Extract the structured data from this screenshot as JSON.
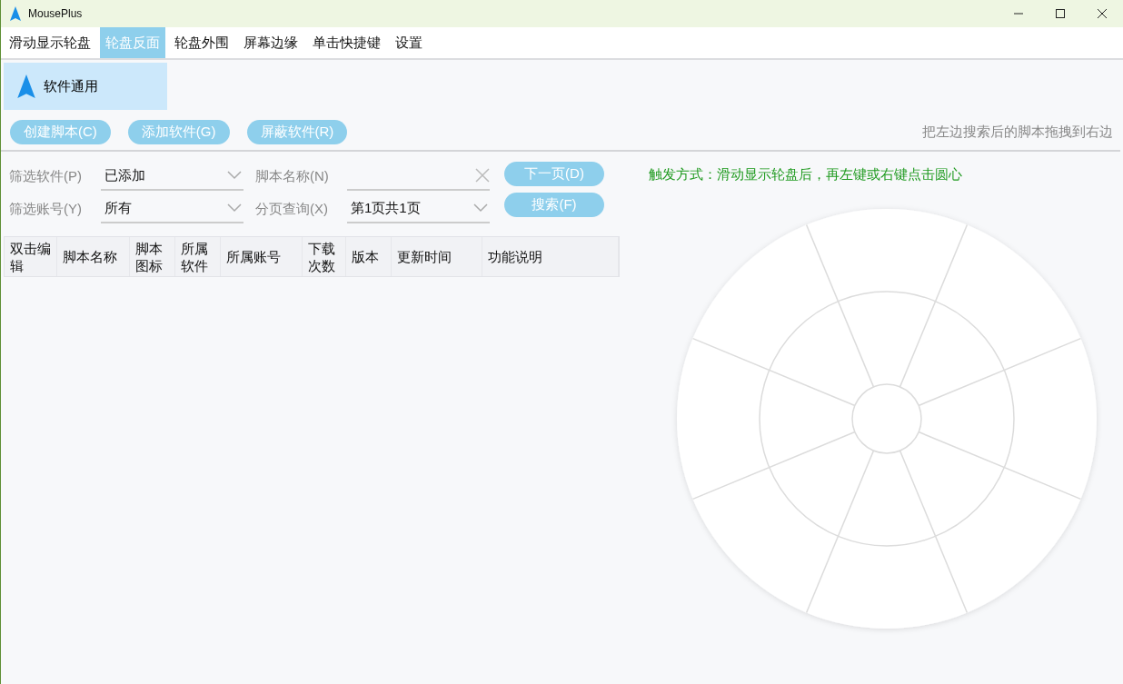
{
  "window": {
    "title": "MousePlus"
  },
  "menu": [
    {
      "label": "滑动显示轮盘",
      "selected": false
    },
    {
      "label": "轮盘反面",
      "selected": true
    },
    {
      "label": "轮盘外围",
      "selected": false
    },
    {
      "label": "屏幕边缘",
      "selected": false
    },
    {
      "label": "单击快捷键",
      "selected": false
    },
    {
      "label": "设置",
      "selected": false
    }
  ],
  "software_tabs": [
    {
      "label": "软件通用",
      "selected": true
    }
  ],
  "toolbar_buttons": [
    "创建脚本(C)",
    "添加软件(G)",
    "屏蔽软件(R)"
  ],
  "hint": "把左边搜索后的脚本拖拽到右边",
  "filters": [
    {
      "kind": "dropdown",
      "label": "筛选软件(P)",
      "value": "已添加"
    },
    {
      "kind": "search",
      "label": "脚本名称(N)"
    },
    {
      "kind": "dropdown",
      "label": "筛选账号(Y)",
      "value": "所有"
    },
    {
      "kind": "dropdown",
      "label": "分页查询(X)",
      "value": "第1页共1页"
    }
  ],
  "action_buttons": [
    "下一页(D)",
    "搜索(F)"
  ],
  "table": {
    "columns": [
      "双击编辑",
      "脚本名称",
      "脚本图标",
      "所属软件",
      "所属账号",
      "下载次数",
      "版本",
      "更新时间",
      "功能说明"
    ]
  },
  "trigger_text": "触发方式：滑动显示轮盘后，再左键或右键点击圆心"
}
